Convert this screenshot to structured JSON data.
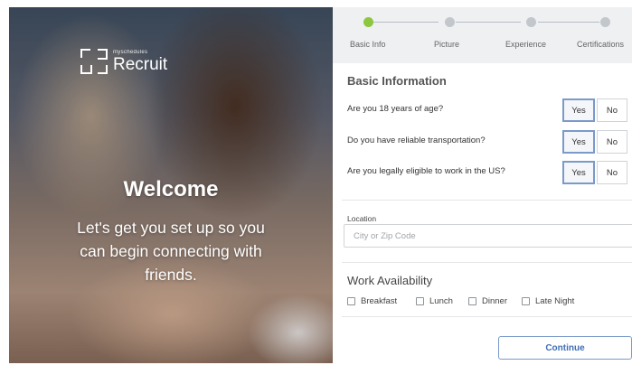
{
  "hero": {
    "logo_small": "myschedules",
    "logo_name": "Recruit",
    "welcome": "Welcome",
    "tagline_line1": "Let's get you set up so you",
    "tagline_line2": "can begin connecting with",
    "tagline_line3": "friends."
  },
  "stepper": {
    "steps": [
      {
        "label": "Basic Info",
        "active": true
      },
      {
        "label": "Picture",
        "active": false
      },
      {
        "label": "Experience",
        "active": false
      },
      {
        "label": "Certifications",
        "active": false
      }
    ],
    "active_color": "#8dc63f"
  },
  "basic_info": {
    "title": "Basic Information",
    "questions": [
      {
        "text": "Are you 18 years of age?",
        "yes": "Yes",
        "no": "No",
        "selected": "Yes"
      },
      {
        "text": "Do you have reliable transportation?",
        "yes": "Yes",
        "no": "No",
        "selected": "Yes"
      },
      {
        "text": "Are you legally eligible to work in the US?",
        "yes": "Yes",
        "no": "No",
        "selected": "Yes"
      }
    ]
  },
  "location": {
    "label": "Location",
    "placeholder": "City or Zip Code",
    "value": ""
  },
  "work_availability": {
    "title": "Work Availability",
    "options": [
      {
        "label": "Breakfast",
        "checked": false
      },
      {
        "label": "Lunch",
        "checked": false
      },
      {
        "label": "Dinner",
        "checked": false
      },
      {
        "label": "Late Night",
        "checked": false
      }
    ]
  },
  "actions": {
    "continue_label": "Continue",
    "accent": "#3f6fb5"
  }
}
